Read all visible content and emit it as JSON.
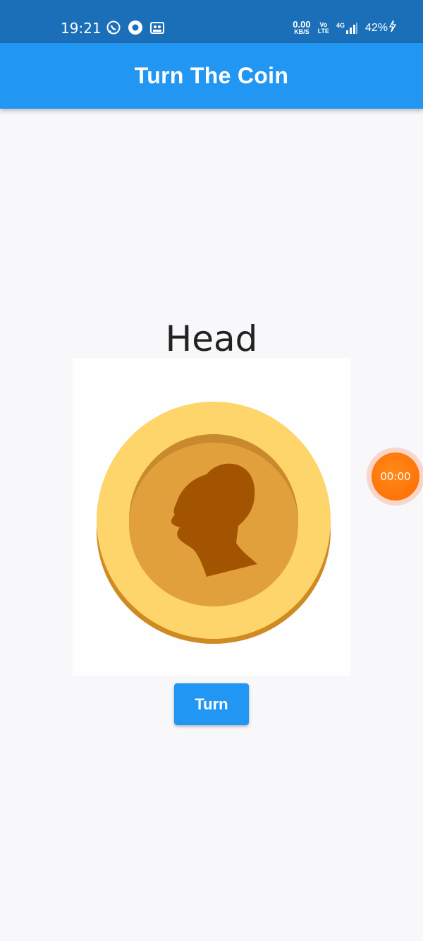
{
  "status_bar": {
    "time": "19:21",
    "net_speed_value": "0.00",
    "net_speed_unit": "KB/S",
    "volte_top": "Vo",
    "volte_bottom": "LTE",
    "network_type": "4G",
    "battery_percent": "42%",
    "icons": [
      "whatsapp-icon",
      "record-icon",
      "gallery-icon",
      "signal-icon",
      "charging-icon"
    ]
  },
  "app_bar": {
    "title": "Turn The Coin",
    "color": "#2196f3"
  },
  "coin": {
    "face_label": "Head",
    "image": "coin-head-icon"
  },
  "actions": {
    "turn_label": "Turn"
  },
  "recorder": {
    "timer": "00:00",
    "color": "#ff7a0a"
  },
  "colors": {
    "status_bar": "#1b6fb8",
    "background": "#f8f7fa",
    "coin_rim": "#fdd56b",
    "coin_inner": "#e2a03c",
    "silhouette": "#a35400"
  }
}
